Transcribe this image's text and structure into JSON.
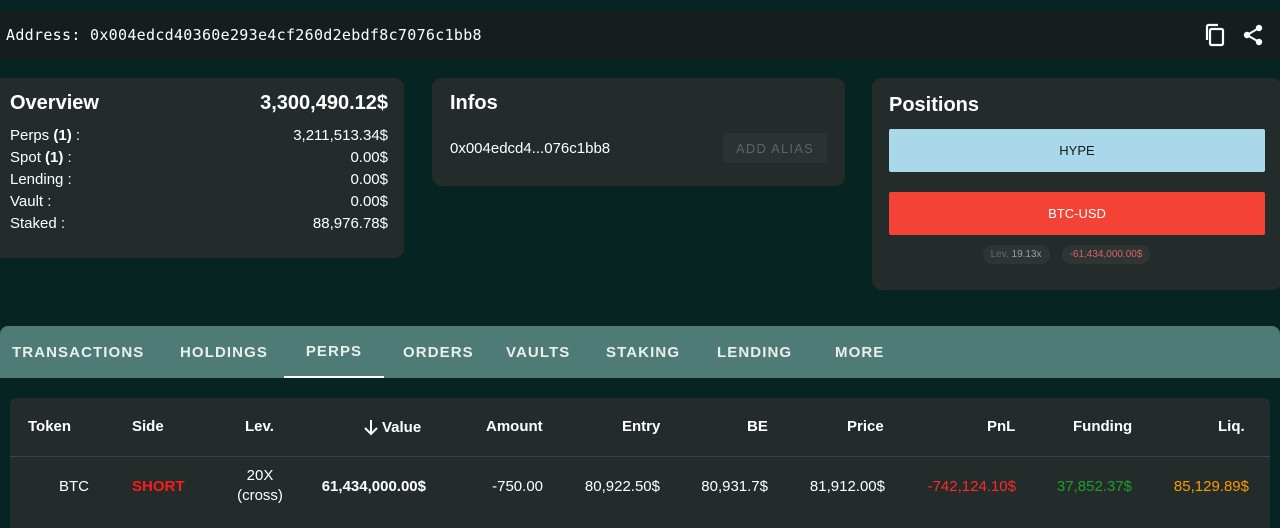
{
  "header": {
    "address_label": "Address:",
    "address": "0x004edcd40360e293e4cf260d2ebdf8c7076c1bb8",
    "icons": [
      "copy-icon",
      "share-icon"
    ]
  },
  "overview": {
    "title": "Overview",
    "total": "3,300,490.12$",
    "rows": [
      {
        "label": "Perps",
        "count": "(1)",
        "suffix": " :",
        "value": "3,211,513.34$"
      },
      {
        "label": "Spot",
        "count": "(1)",
        "suffix": " :",
        "value": "0.00$"
      },
      {
        "label": "Lending :",
        "value": "0.00$"
      },
      {
        "label": "Vault :",
        "value": "0.00$"
      },
      {
        "label": "Staked :",
        "value": "88,976.78$"
      }
    ]
  },
  "infos": {
    "title": "Infos",
    "short_address": "0x004edcd4...076c1bb8",
    "alias_button": "ADD ALIAS"
  },
  "positions": {
    "title": "Positions",
    "items": [
      "HYPE",
      "BTC-USD"
    ],
    "lev_label": "Lev.",
    "lev_value": "19.13x",
    "value": "-61,434,000.00$"
  },
  "tabs": [
    "TRANSACTIONS",
    "HOLDINGS",
    "PERPS",
    "ORDERS",
    "VAULTS",
    "STAKING",
    "LENDING",
    "MORE"
  ],
  "active_tab": "PERPS",
  "table": {
    "headers": [
      "Token",
      "Side",
      "Lev.",
      "Value",
      "Amount",
      "Entry",
      "BE",
      "Price",
      "PnL",
      "Funding",
      "Liq."
    ],
    "rows": [
      {
        "token": "BTC",
        "side": "SHORT",
        "lev_line1": "20X",
        "lev_line2": "(cross)",
        "value": "61,434,000.00$",
        "amount": "-750.00",
        "entry": "80,922.50$",
        "be": "80,931.7$",
        "price": "81,912.00$",
        "pnl": "-742,124.10$",
        "funding": "37,852.37$",
        "liq": "85,129.89$"
      }
    ]
  },
  "colors": {
    "short": "#ff1a1a",
    "pnl_negative": "#ff2a2a",
    "funding_positive": "#1e9e2e",
    "liq": "#ff9800",
    "hype": "#a8d8ea",
    "btc": "#f44336"
  }
}
